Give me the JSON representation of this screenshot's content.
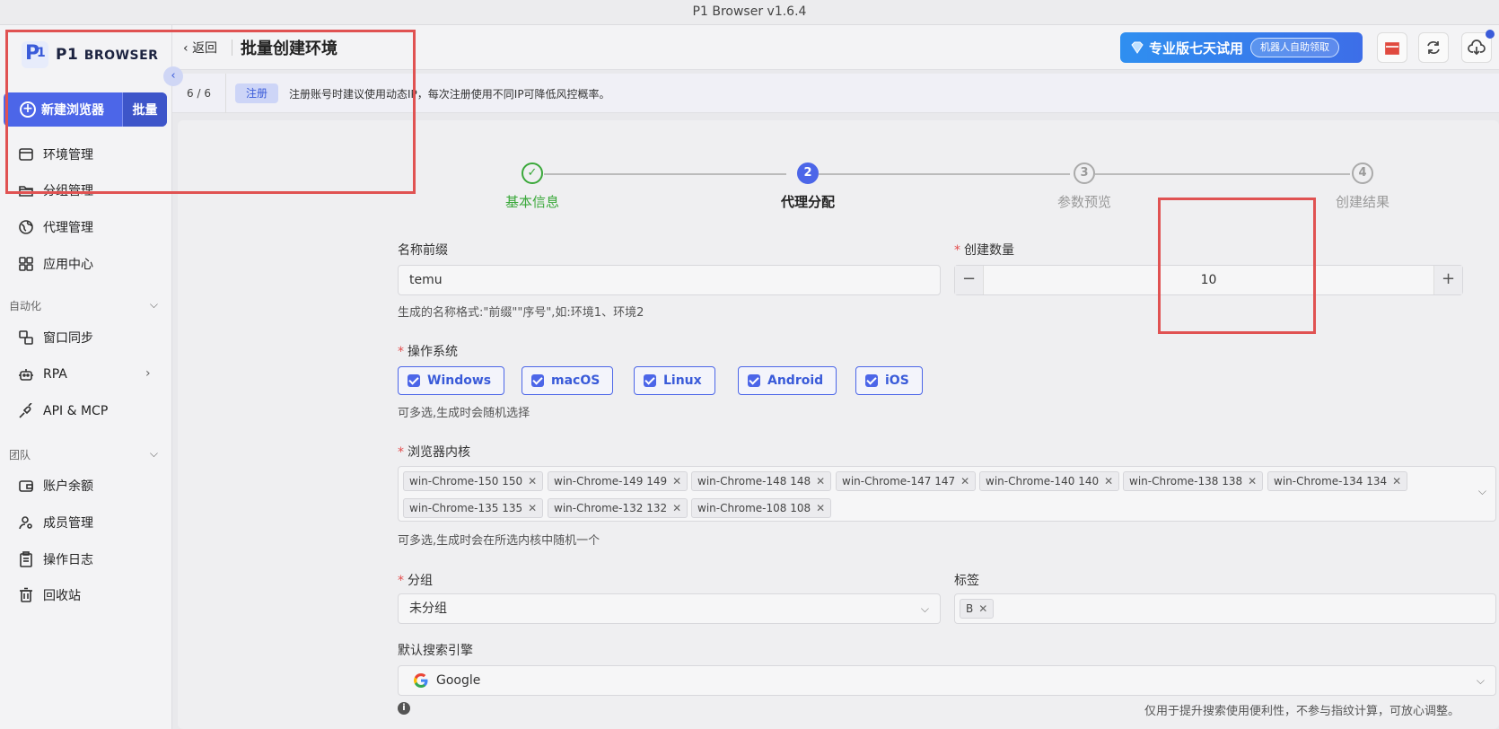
{
  "window": {
    "title": "P1 Browser v1.6.4"
  },
  "sidebar": {
    "logo_text_main": "P1",
    "logo_text_sub": "BROWSER",
    "new_browser_label": "新建浏览器",
    "batch_label": "批量",
    "items": [
      {
        "label": "环境管理",
        "icon": "browser-window-icon"
      },
      {
        "label": "分组管理",
        "icon": "folder-icon"
      },
      {
        "label": "代理管理",
        "icon": "globe-icon"
      },
      {
        "label": "应用中心",
        "icon": "grid-icon"
      }
    ],
    "section_automation": "自动化",
    "automation_items": [
      {
        "label": "窗口同步",
        "icon": "window-sync-icon"
      },
      {
        "label": "RPA",
        "icon": "robot-icon"
      },
      {
        "label": "API & MCP",
        "icon": "plug-icon"
      }
    ],
    "section_team": "团队",
    "team_items": [
      {
        "label": "账户余额",
        "icon": "wallet-icon"
      },
      {
        "label": "成员管理",
        "icon": "user-gear-icon"
      },
      {
        "label": "操作日志",
        "icon": "clipboard-icon"
      },
      {
        "label": "回收站",
        "icon": "trash-icon"
      }
    ]
  },
  "header": {
    "back_label": "返回",
    "title": "批量创建环境",
    "promo_text": "专业版七天试用",
    "promo_pill": "机器人自助领取"
  },
  "infobar": {
    "count": "6 / 6",
    "tag": "注册",
    "message": "注册账号时建议使用动态IP，每次注册使用不同IP可降低风控概率。"
  },
  "steps": [
    {
      "num": "✓",
      "label": "基本信息",
      "state": "done"
    },
    {
      "num": "2",
      "label": "代理分配",
      "state": "active"
    },
    {
      "num": "3",
      "label": "参数预览",
      "state": "pending"
    },
    {
      "num": "4",
      "label": "创建结果",
      "state": "pending"
    }
  ],
  "form": {
    "name_prefix_label": "名称前缀",
    "name_prefix_value": "temu",
    "name_prefix_hint": "生成的名称格式:\"前缀\"\"序号\",如:环境1、环境2",
    "count_label": "创建数量",
    "count_value": "10",
    "os_label": "操作系统",
    "os_options": [
      "Windows",
      "macOS",
      "Linux",
      "Android",
      "iOS"
    ],
    "os_hint": "可多选,生成时会随机选择",
    "kernel_label": "浏览器内核",
    "kernels_row1": [
      "win-Chrome-150 150",
      "win-Chrome-149 149",
      "win-Chrome-148 148",
      "win-Chrome-147 147",
      "win-Chrome-140 140",
      "win-Chrome-138 138",
      "win-Chrome-134 134"
    ],
    "kernels_row2": [
      "win-Chrome-135 135",
      "win-Chrome-132 132",
      "win-Chrome-108 108"
    ],
    "kernel_hint": "可多选,生成时会在所选内核中随机一个",
    "group_label": "分组",
    "group_value": "未分组",
    "tag_label": "标签",
    "tag_value": "B",
    "search_label": "默认搜索引擎",
    "search_value": "Google",
    "search_hint": "仅用于提升搜索使用便利性，不参与指纹计算，可放心调整。"
  },
  "colors": {
    "accent": "#4c66e8",
    "success": "#3aa83a",
    "highlight": "#e05252"
  }
}
